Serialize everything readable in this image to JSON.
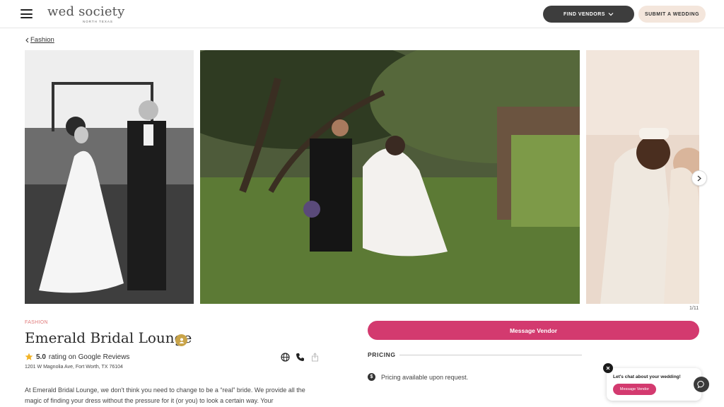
{
  "header": {
    "logo_text": "wed society",
    "logo_subtext": "NORTH TEXAS",
    "find_vendors_label": "FIND VENDORS",
    "submit_wedding_label": "SUBMIT A WEDDING"
  },
  "breadcrumb": {
    "label": "Fashion"
  },
  "gallery": {
    "counter": "1/11"
  },
  "vendor": {
    "category": "FASHION",
    "name": "Emerald Bridal Lounge",
    "rating_value": "5.0",
    "rating_text": "rating on Google Reviews",
    "address": "1201 W Magnolia Ave, Fort Worth, TX 76104",
    "description": "At Emerald Bridal Lounge, we don't think you need to change to be a “real” bride. We provide all the magic of finding your dress without the pressure for it (or you) to look a certain way. Your"
  },
  "actions": {
    "message_vendor_label": "Message Vendor"
  },
  "pricing": {
    "label": "PRICING",
    "text": "Pricing available upon request."
  },
  "chat": {
    "prompt": "Let's chat about your wedding!",
    "button_label": "Message Vendor"
  },
  "colors": {
    "accent_pink": "#d33a6f",
    "dark_button": "#3d3d3d",
    "submit_button": "#f4e6dc",
    "category": "#e07a7a",
    "badge_gold": "#c9a449"
  },
  "icons": [
    "hamburger-icon",
    "chevron-down-icon",
    "chevron-left-icon",
    "chevron-right-icon",
    "verified-badge-icon",
    "star-icon",
    "globe-icon",
    "phone-icon",
    "share-icon",
    "dollar-icon",
    "close-icon",
    "chat-icon"
  ]
}
